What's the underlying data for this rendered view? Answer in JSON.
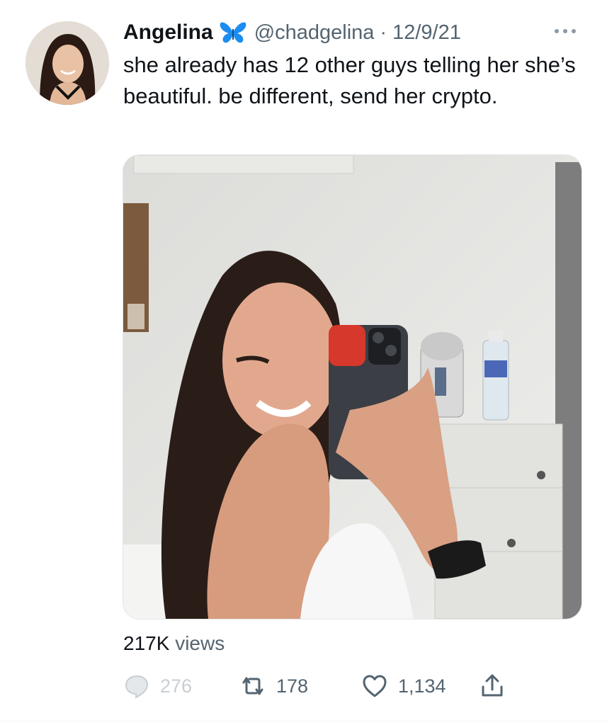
{
  "tweet": {
    "display_name": "Angelina",
    "handle": "@chadgelina",
    "separator": "·",
    "date": "12/9/21",
    "text": "she already has 12 other guys telling her she’s beautiful. be different, send her crypto.",
    "views_count": "217K",
    "views_label": "views",
    "replies": "276",
    "retweets": "178",
    "likes": "1,134"
  },
  "icons": {
    "verified_emoji": "butterfly-icon",
    "more": "more-icon",
    "reply": "reply-icon",
    "retweet": "retweet-icon",
    "like": "heart-icon",
    "share": "share-icon"
  },
  "colors": {
    "text_primary": "#0f1419",
    "text_secondary": "#536471",
    "butterfly": "#1d8cf0",
    "reply_faded": "#c9ced3"
  }
}
